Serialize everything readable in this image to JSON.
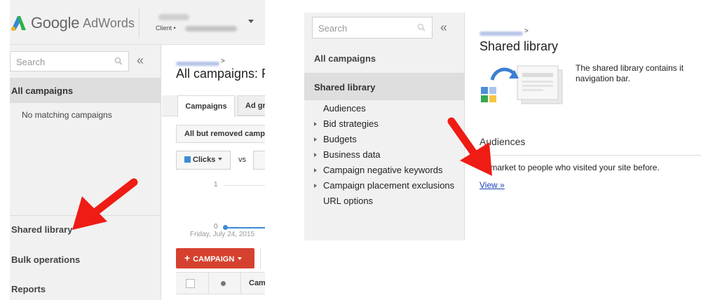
{
  "left_panel": {
    "brand": {
      "google": "Google",
      "product": "AdWords"
    },
    "account": {
      "client_label": "Client •"
    },
    "sidebar": {
      "search_placeholder": "Search",
      "collapse_glyph": "«",
      "all_campaigns": "All campaigns",
      "empty_message": "No matching campaigns",
      "nav": {
        "shared_library": "Shared library",
        "bulk_operations": "Bulk operations",
        "reports": "Reports"
      }
    },
    "main": {
      "breadcrumb_caret": ">",
      "title": "All campaigns: F",
      "tabs": [
        "Campaigns",
        "Ad gr"
      ],
      "filter": "All but removed camp",
      "metric": {
        "label": "Clicks",
        "color": "#3d8bd4"
      },
      "compare_label": "vs",
      "chart": {
        "y_labels": [
          "1",
          "0"
        ],
        "x_label": "Friday, July 24, 2015"
      },
      "campaign_button": {
        "plus": "+",
        "label": "CAMPAIGN",
        "color": "#d6412f"
      },
      "table_header": {
        "column": "Cam"
      }
    }
  },
  "right_panel": {
    "sidebar": {
      "search_placeholder": "Search",
      "collapse_glyph": "«",
      "all_campaigns": "All campaigns",
      "shared_library": "Shared library",
      "library_items": [
        {
          "label": "Audiences",
          "expandable": false
        },
        {
          "label": "Bid strategies",
          "expandable": true
        },
        {
          "label": "Budgets",
          "expandable": true
        },
        {
          "label": "Business data",
          "expandable": true
        },
        {
          "label": "Campaign negative keywords",
          "expandable": true
        },
        {
          "label": "Campaign placement exclusions",
          "expandable": true
        },
        {
          "label": "URL options",
          "expandable": false
        }
      ]
    },
    "content": {
      "breadcrumb_caret": ">",
      "title": "Shared library",
      "description": "The shared library contains it navigation bar.",
      "section_title": "Audiences",
      "section_text": "Remarket to people who visited your site before.",
      "link_text": "View »"
    }
  },
  "annotations": {
    "arrow_color": "#ee1c14"
  }
}
